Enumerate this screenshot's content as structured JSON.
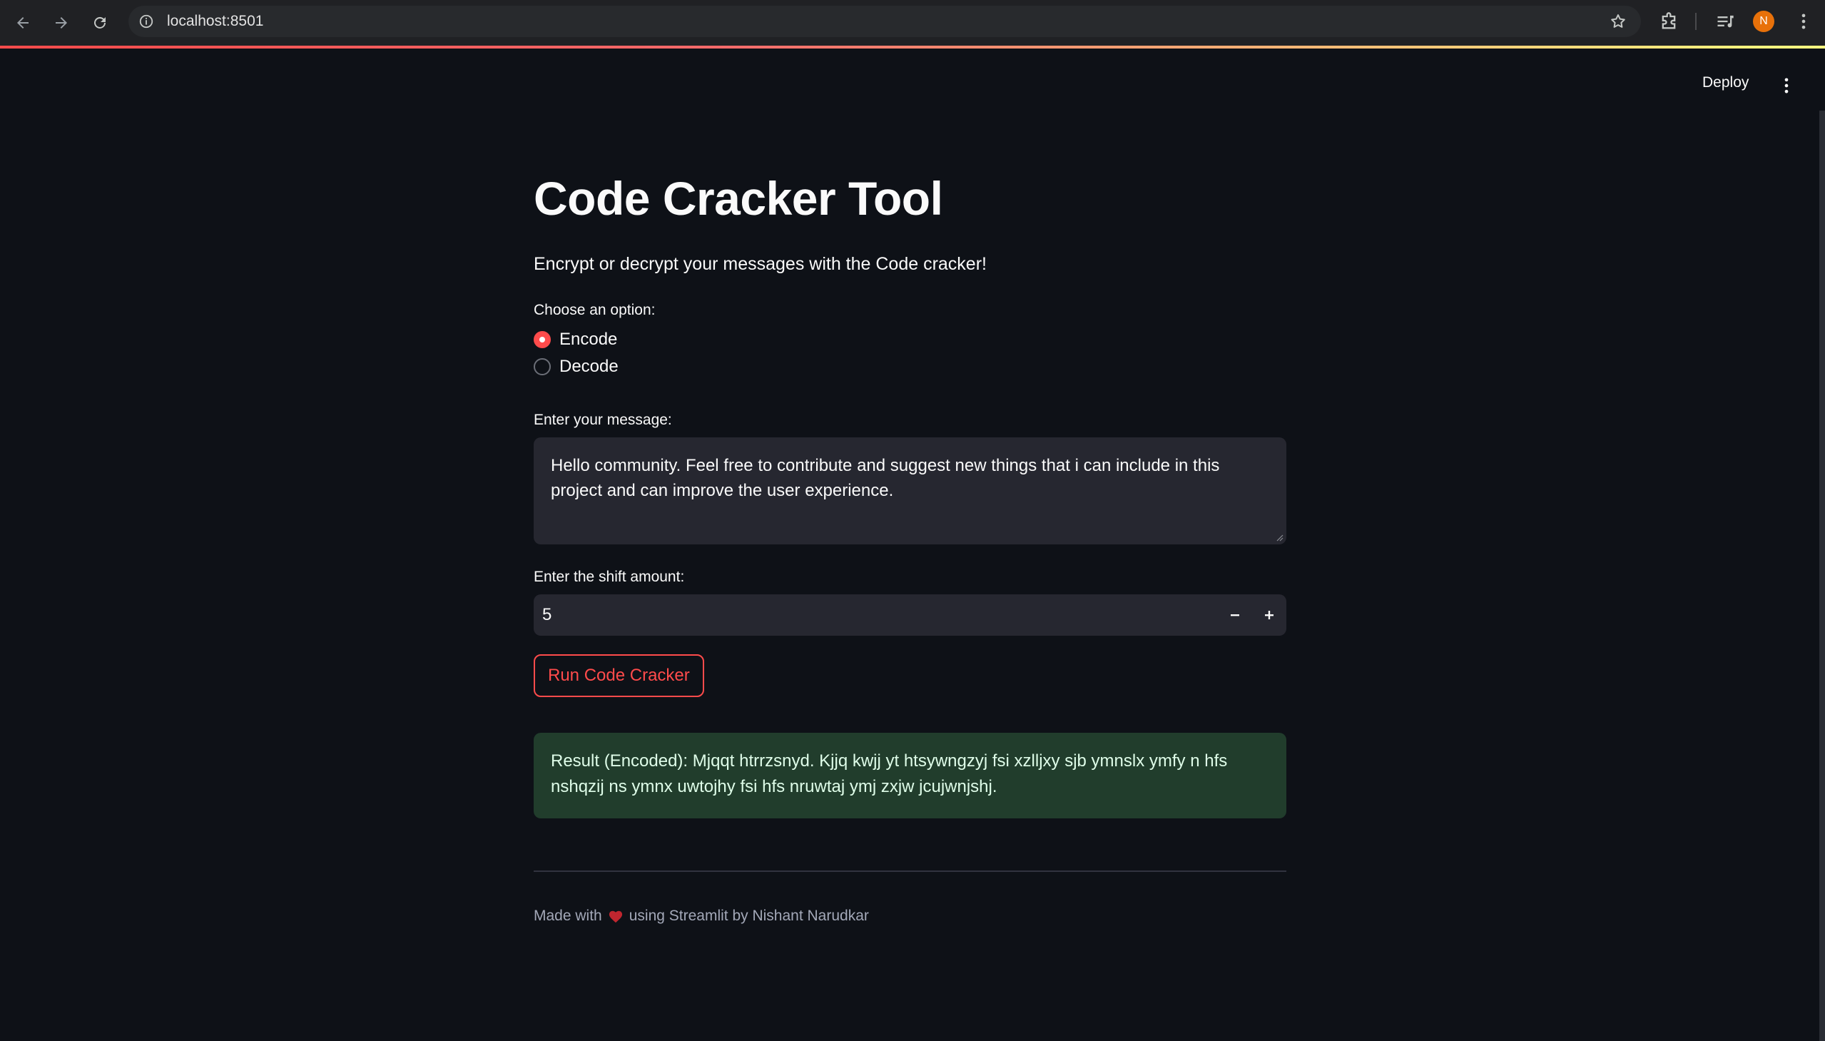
{
  "browser": {
    "url": "localhost:8501",
    "profile_initial": "N",
    "avatar_color": "#e8710a"
  },
  "header": {
    "deploy_label": "Deploy"
  },
  "app": {
    "title": "Code Cracker Tool",
    "subtitle": "Encrypt or decrypt your messages with the Code cracker!",
    "option_label": "Choose an option:",
    "options": [
      {
        "label": "Encode",
        "selected": true
      },
      {
        "label": "Decode",
        "selected": false
      }
    ],
    "message_label": "Enter your message:",
    "message_value": "Hello community. Feel free to contribute and suggest new things that i can include in this project and can improve the user experience.",
    "shift_label": "Enter the shift amount:",
    "shift_value": "5",
    "run_button": "Run Code Cracker",
    "result_text": "Result (Encoded): Mjqqt htrrzsnyd. Kjjq kwjj yt htsywngzyj fsi xzlljxy sjb ymnslx ymfy n hfs nshqzij ns ymnx uwtojhy fsi hfs nruwtaj ymj zxjw jcujwnjshj.",
    "footer_prefix": "Made with",
    "footer_suffix": "using Streamlit by Nishant Narudkar"
  },
  "colors": {
    "background": "#0e1117",
    "primary": "#ff4b4b",
    "input_bg": "#262730",
    "success_bg": "#213d2c"
  }
}
